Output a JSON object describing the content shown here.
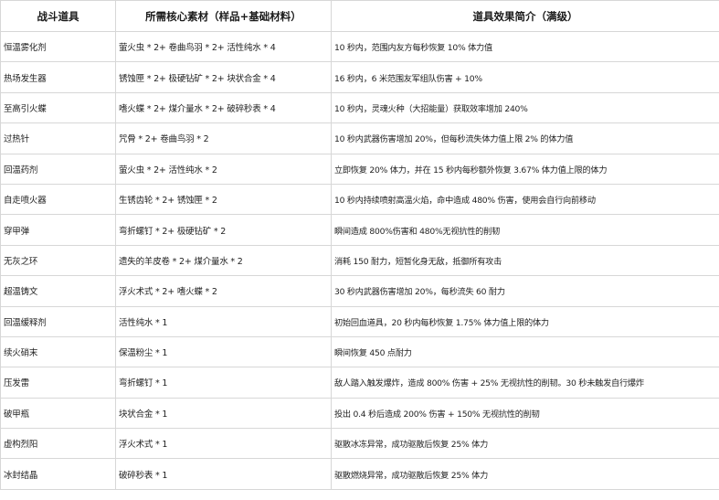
{
  "table": {
    "headers": [
      "战斗道具",
      "所需核心素材（样品+基础材料）",
      "道具效果简介（满级）"
    ],
    "rows": [
      {
        "name": "恒温雾化剂",
        "materials": "萤火虫 * 2+ 卷曲鸟羽 * 2+ 活性纯水 * 4",
        "effect": "10 秒内，范围内友方每秒恢复 10% 体力值"
      },
      {
        "name": "热场发生器",
        "materials": "锈蚀匣 * 2+ 极硬钻矿 * 2+ 块状合金 * 4",
        "effect": "16 秒内，6 米范围友军组队伤害 + 10%"
      },
      {
        "name": "至高引火蝶",
        "materials": "嗜火蝶 * 2+ 煤介量水 * 2+ 破碎秒表 * 4",
        "effect": "10 秒内，灵魂火种（大招能量）获取效率增加 240%"
      },
      {
        "name": "过热针",
        "materials": "咒骨 * 2+ 卷曲鸟羽 * 2",
        "effect": "10 秒内武器伤害增加 20%，但每秒流失体力值上限 2% 的体力值"
      },
      {
        "name": "回温药剂",
        "materials": "萤火虫 * 2+ 活性纯水 * 2",
        "effect": "立即恢复 20% 体力，并在 15 秒内每秒额外恢复 3.67% 体力值上限的体力"
      },
      {
        "name": "自走喷火器",
        "materials": "生锈齿轮 * 2+ 锈蚀匣 * 2",
        "effect": "10 秒内持续喷射高温火焰，命中造成 480% 伤害，使用会自行向前移动"
      },
      {
        "name": "穿甲弹",
        "materials": "弯折螺钉 * 2+ 极硬钻矿 * 2",
        "effect": "瞬间造成 800%伤害和 480%无视抗性的削韧"
      },
      {
        "name": "无灰之环",
        "materials": "遗失的羊皮卷 * 2+ 煤介量水 * 2",
        "effect": "消耗 150 耐力，短暂化身无敌，抵御所有攻击"
      },
      {
        "name": "超温铸文",
        "materials": "浮火术式 * 2+ 嗜火蝶 * 2",
        "effect": "30 秒内武器伤害增加 20%，每秒流失 60 耐力"
      },
      {
        "name": "回温缓释剂",
        "materials": "活性纯水 * 1",
        "effect": "初始回血道具，20 秒内每秒恢复 1.75% 体力值上限的体力"
      },
      {
        "name": "续火硝末",
        "materials": "保温粉尘 * 1",
        "effect": "瞬间恢复 450 点耐力"
      },
      {
        "name": "压发雷",
        "materials": "弯折螺钉 * 1",
        "effect": "敌人踏入触发爆炸，造成 800% 伤害 + 25% 无视抗性的削韧。30 秒未触发自行爆炸"
      },
      {
        "name": "破甲瓶",
        "materials": "块状合金 * 1",
        "effect": "投出 0.4 秒后造成 200% 伤害 + 150% 无视抗性的削韧"
      },
      {
        "name": "虚构烈阳",
        "materials": "浮火术式 * 1",
        "effect": "驱散冰冻异常，成功驱散后恢复 25% 体力"
      },
      {
        "name": "冰封结晶",
        "materials": "破碎秒表 * 1",
        "effect": "驱散燃烧异常，成功驱散后恢复 25% 体力"
      }
    ]
  }
}
